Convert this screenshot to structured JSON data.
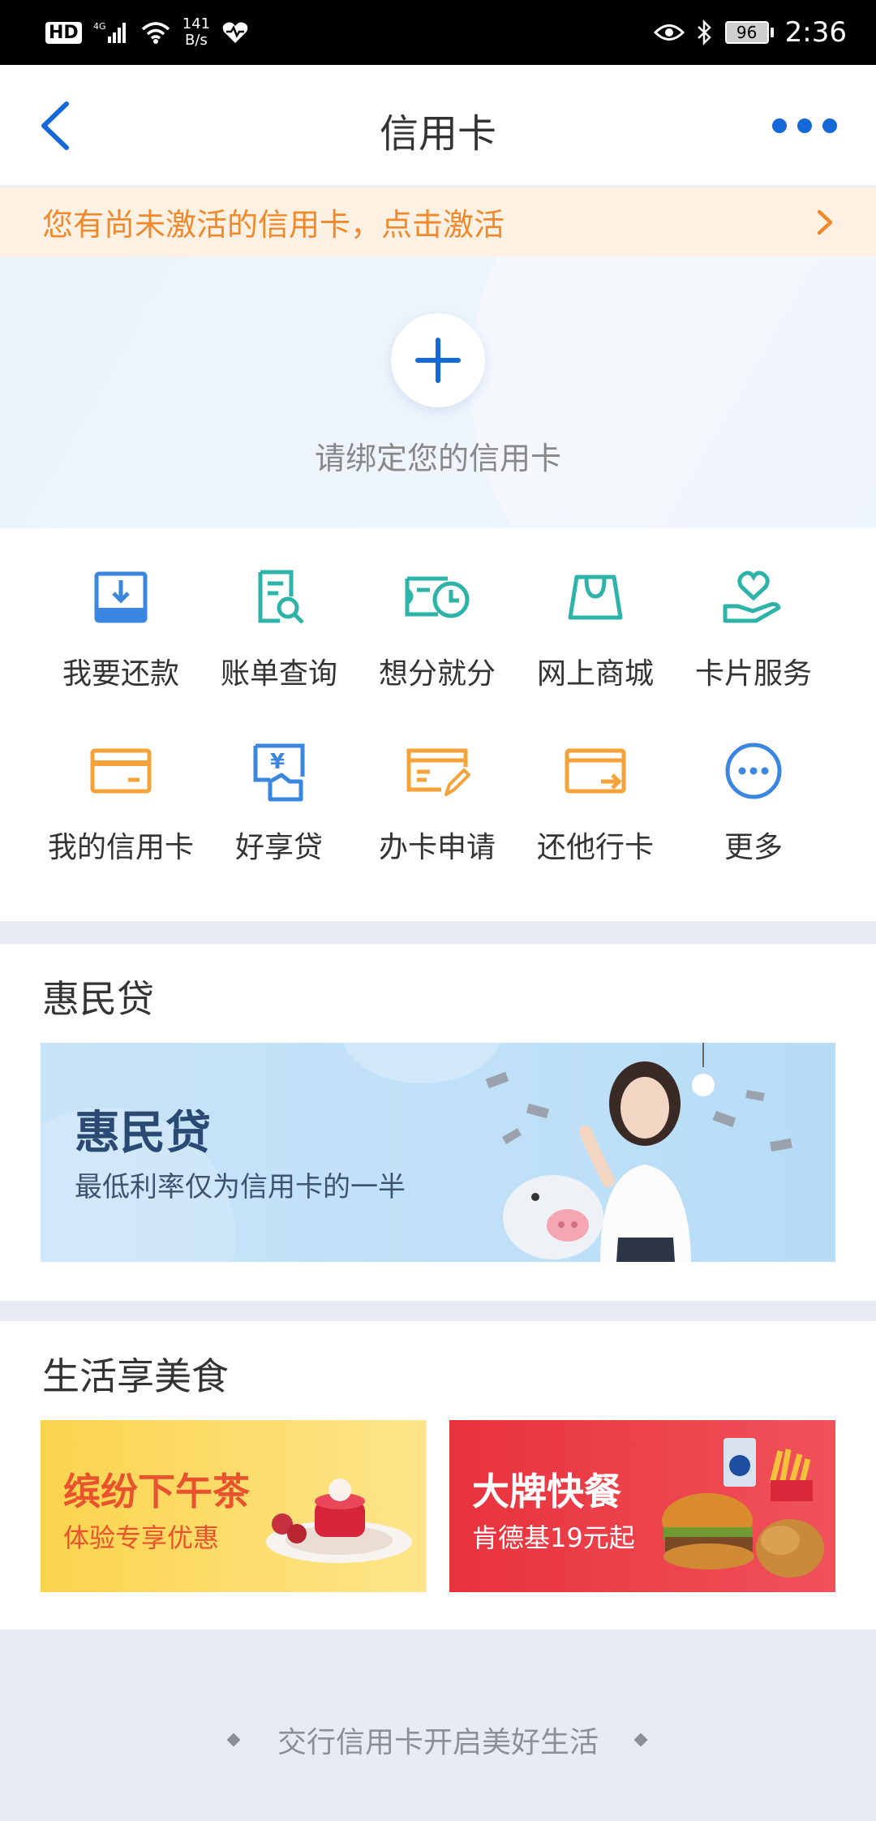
{
  "status_bar": {
    "hd": "HD",
    "network": "4G",
    "speed_top": "141",
    "speed_bottom": "B/s",
    "battery": "96",
    "time": "2:36"
  },
  "header": {
    "title": "信用卡"
  },
  "notice": {
    "text": "您有尚未激活的信用卡，点击激活"
  },
  "bind": {
    "label": "请绑定您的信用卡"
  },
  "menu": {
    "items": [
      {
        "label": "我要还款",
        "icon": "repay-icon"
      },
      {
        "label": "账单查询",
        "icon": "bill-search-icon"
      },
      {
        "label": "想分就分",
        "icon": "installment-icon"
      },
      {
        "label": "网上商城",
        "icon": "shopping-bag-icon"
      },
      {
        "label": "卡片服务",
        "icon": "card-service-icon"
      },
      {
        "label": "我的信用卡",
        "icon": "my-card-icon"
      },
      {
        "label": "好享贷",
        "icon": "loan-icon"
      },
      {
        "label": "办卡申请",
        "icon": "apply-card-icon"
      },
      {
        "label": "还他行卡",
        "icon": "other-bank-card-icon"
      },
      {
        "label": "更多",
        "icon": "more-icon"
      }
    ],
    "colors": {
      "blue": "#3a86e0",
      "teal": "#2eb3a8",
      "orange": "#f5a23a"
    }
  },
  "loan_section": {
    "title": "惠民贷",
    "banner_title": "惠民贷",
    "banner_subtitle": "最低利率仅为信用卡的一半"
  },
  "food_section": {
    "title": "生活享美食",
    "cards": [
      {
        "title": "缤纷下午茶",
        "subtitle": "体验专享优惠"
      },
      {
        "title": "大牌快餐",
        "subtitle": "肯德基19元起"
      }
    ]
  },
  "footer": {
    "slogan": "交行信用卡开启美好生活"
  }
}
